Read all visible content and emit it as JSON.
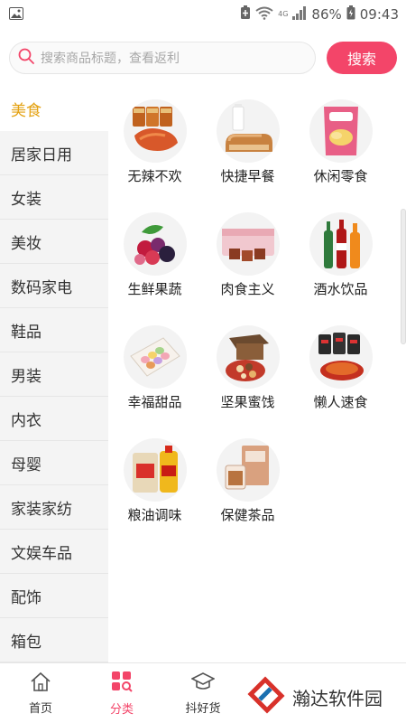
{
  "status_bar": {
    "battery": "86%",
    "time": "09:43",
    "icons": [
      "image-icon",
      "battery-saver-icon",
      "wifi-icon",
      "4g-icon",
      "signal-icon",
      "battery-icon"
    ]
  },
  "search": {
    "placeholder": "搜索商品标题，查看返利",
    "button_label": "搜索",
    "accent_color": "#f34569"
  },
  "sidebar": {
    "active_color": "#e4a213",
    "items": [
      {
        "label": "美食",
        "active": true
      },
      {
        "label": "居家日用"
      },
      {
        "label": "女装"
      },
      {
        "label": "美妆"
      },
      {
        "label": "数码家电"
      },
      {
        "label": "鞋品"
      },
      {
        "label": "男装"
      },
      {
        "label": "内衣"
      },
      {
        "label": "母婴"
      },
      {
        "label": "家装家纺"
      },
      {
        "label": "文娱车品"
      },
      {
        "label": "配饰"
      },
      {
        "label": "箱包"
      }
    ]
  },
  "categories": [
    {
      "label": "无辣不欢",
      "icon": "spicy-snack-icon"
    },
    {
      "label": "快捷早餐",
      "icon": "bread-milk-icon"
    },
    {
      "label": "休闲零食",
      "icon": "chips-bag-icon"
    },
    {
      "label": "生鲜果蔬",
      "icon": "berries-icon"
    },
    {
      "label": "肉食主义",
      "icon": "meat-box-icon"
    },
    {
      "label": "酒水饮品",
      "icon": "drink-bottles-icon"
    },
    {
      "label": "幸福甜品",
      "icon": "macaron-box-icon"
    },
    {
      "label": "坚果蜜饯",
      "icon": "nuts-gift-box-icon"
    },
    {
      "label": "懒人速食",
      "icon": "instant-noodles-icon"
    },
    {
      "label": "粮油调味",
      "icon": "rice-oil-icon"
    },
    {
      "label": "保健茶品",
      "icon": "tea-box-icon"
    }
  ],
  "bottom_nav": {
    "items": [
      {
        "label": "首页",
        "icon": "home-icon"
      },
      {
        "label": "分类",
        "icon": "category-icon",
        "active": true
      },
      {
        "label": "抖好货",
        "icon": "graduation-cap-icon"
      }
    ]
  },
  "watermark": {
    "text": "瀚达软件园"
  }
}
